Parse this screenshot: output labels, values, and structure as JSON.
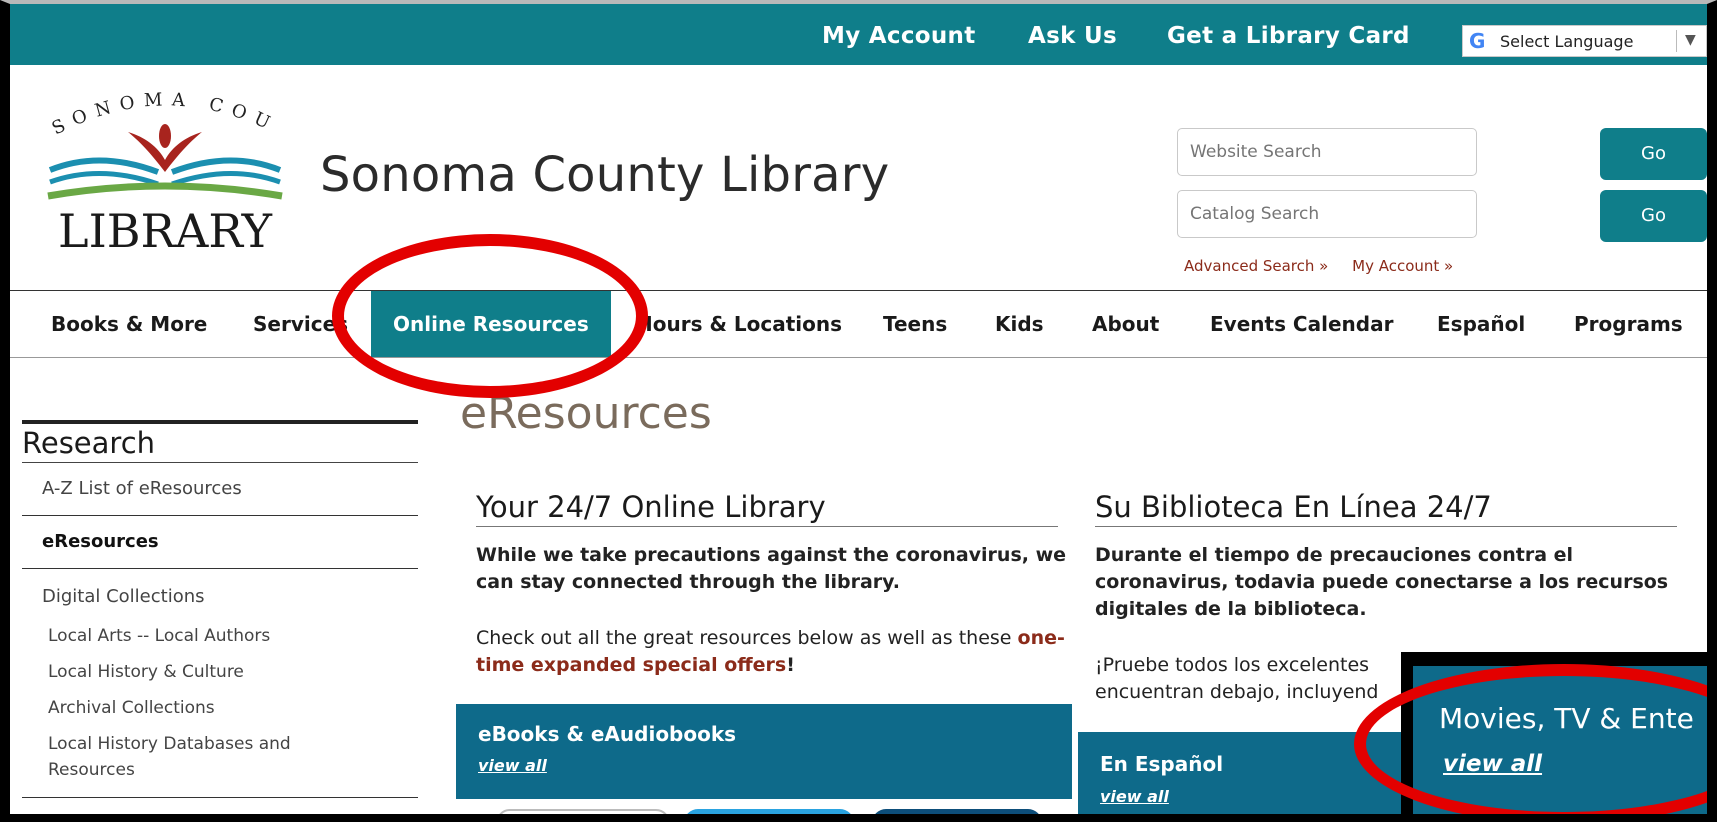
{
  "topbar": {
    "links": [
      "My Account",
      "Ask Us",
      "Get a Library Card"
    ],
    "language_label": "Select Language",
    "language_arrow": "▼",
    "google_glyph": "G"
  },
  "logo": {
    "arc_text": "SONOMA COUNTY",
    "word": "LIBRARY"
  },
  "site_title": "Sonoma County Library",
  "search": {
    "website_placeholder": "Website Search",
    "catalog_placeholder": "Catalog Search",
    "go_label": "Go",
    "advanced_link": "Advanced Search »",
    "account_link": "My Account »"
  },
  "nav": {
    "items": [
      "Books & More",
      "Services",
      "Online Resources",
      "Hours & Locations",
      "Teens",
      "Kids",
      "About",
      "Events Calendar",
      "Español",
      "Programs"
    ]
  },
  "sidebar": {
    "title": "Research",
    "primary": [
      "A-Z List of eResources",
      "eResources",
      "Digital Collections"
    ],
    "sub": [
      "Local Arts -- Local Authors",
      "Local History & Culture",
      "Archival Collections",
      "Local History Databases and Resources"
    ]
  },
  "main": {
    "heading": "eResources",
    "english": {
      "title": "Your 24/7 Online Library",
      "intro": "While we take precautions against the coronavirus, we can stay connected through the library.",
      "check_prefix": "Check out all the great resources below as well as these",
      "offer_link": "one-time expanded special offers",
      "check_suffix": "!"
    },
    "spanish": {
      "title": "Su Biblioteca En Línea 24/7",
      "intro": "Durante el tiempo de precauciones contra el coronavirus, todavia puede conectarse a los recursos digitales de la biblioteca.",
      "line1": "¡Pruebe todos los excelentes",
      "line2": "encuentran debajo, incluyend"
    },
    "panels": {
      "ebooks_title": "eBooks & eAudiobooks",
      "espanol_title": "En Español",
      "view_all": "view all"
    },
    "popup": {
      "title": "Movies, TV & Ente",
      "view_all": "view all"
    }
  },
  "colors": {
    "teal": "#0f7e8a",
    "panel_blue": "#0e6a8a",
    "annotation_red": "#e30000",
    "link_red": "#8b2b1a"
  }
}
